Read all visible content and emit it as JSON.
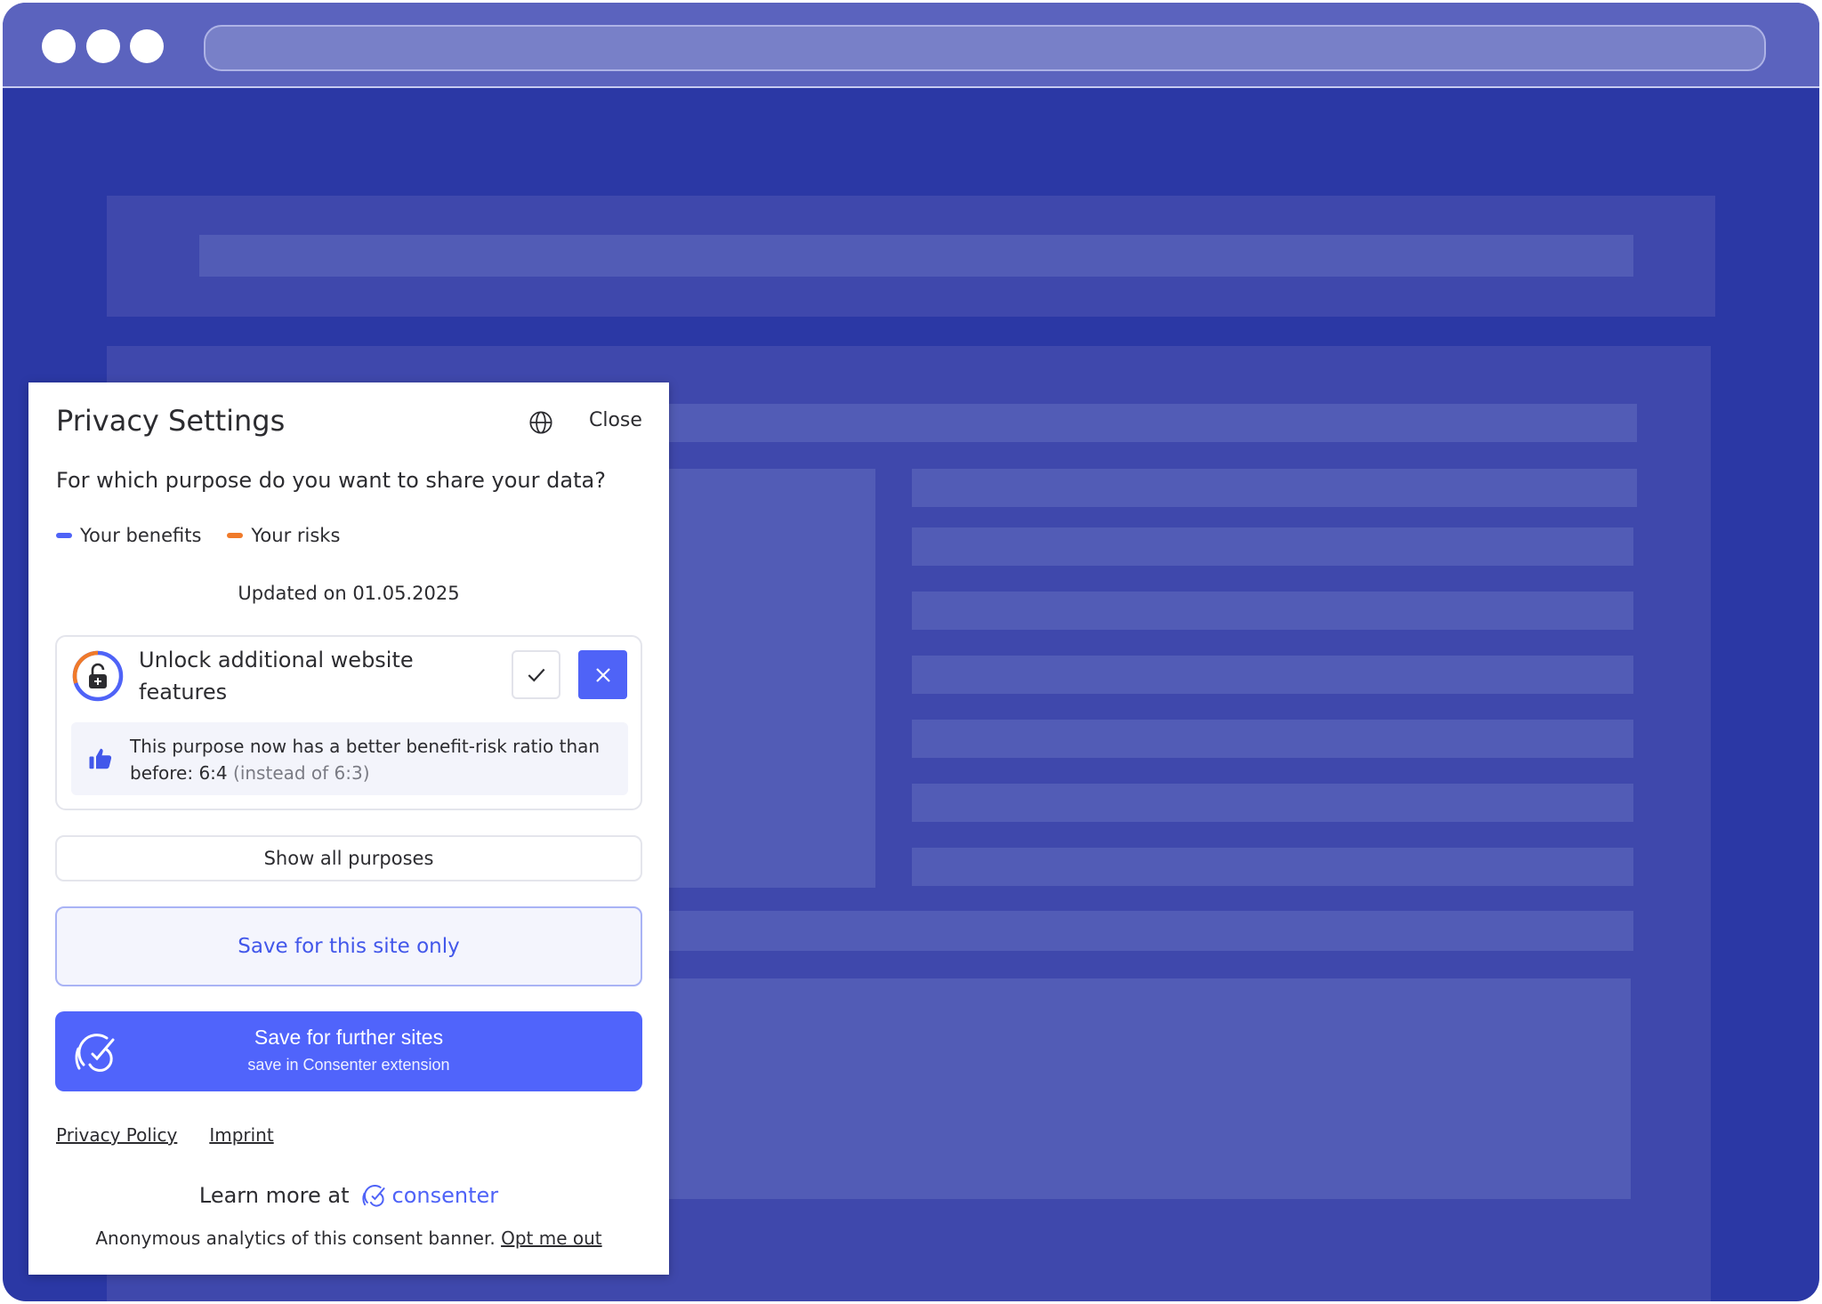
{
  "browser": {
    "window_controls": [
      "close-dot",
      "minimize-dot",
      "maximize-dot"
    ]
  },
  "consent": {
    "title": "Privacy Settings",
    "close_label": "Close",
    "question": "For which purpose do you want to share your data?",
    "legend": {
      "benefits_label": "Your benefits",
      "benefits_color": "#4f63f7",
      "risks_label": "Your risks",
      "risks_color": "#f07a2a"
    },
    "updated": "Updated on 01.05.2025",
    "purpose": {
      "title": "Unlock additional website features",
      "icon": "lock-icon",
      "ratio_text": "This purpose now has a better benefit-risk ratio than before: 6:4",
      "ratio_previous": "(instead of 6:3)"
    },
    "show_all_label": "Show all purposes",
    "save_site_label": "Save for this site only",
    "save_further_label": "Save for further sites",
    "save_further_sub": "save in Consenter extension",
    "links": {
      "privacy_policy": "Privacy Policy",
      "imprint": "Imprint"
    },
    "learn_more_label": "Learn more at",
    "brand_name": "consenter",
    "analytics_text": "Anonymous analytics of this consent banner.",
    "opt_out_label": "Opt me out"
  },
  "colors": {
    "accent": "#4f63f7",
    "page_background": "#2b38a5",
    "titlebar": "#5b63be"
  }
}
